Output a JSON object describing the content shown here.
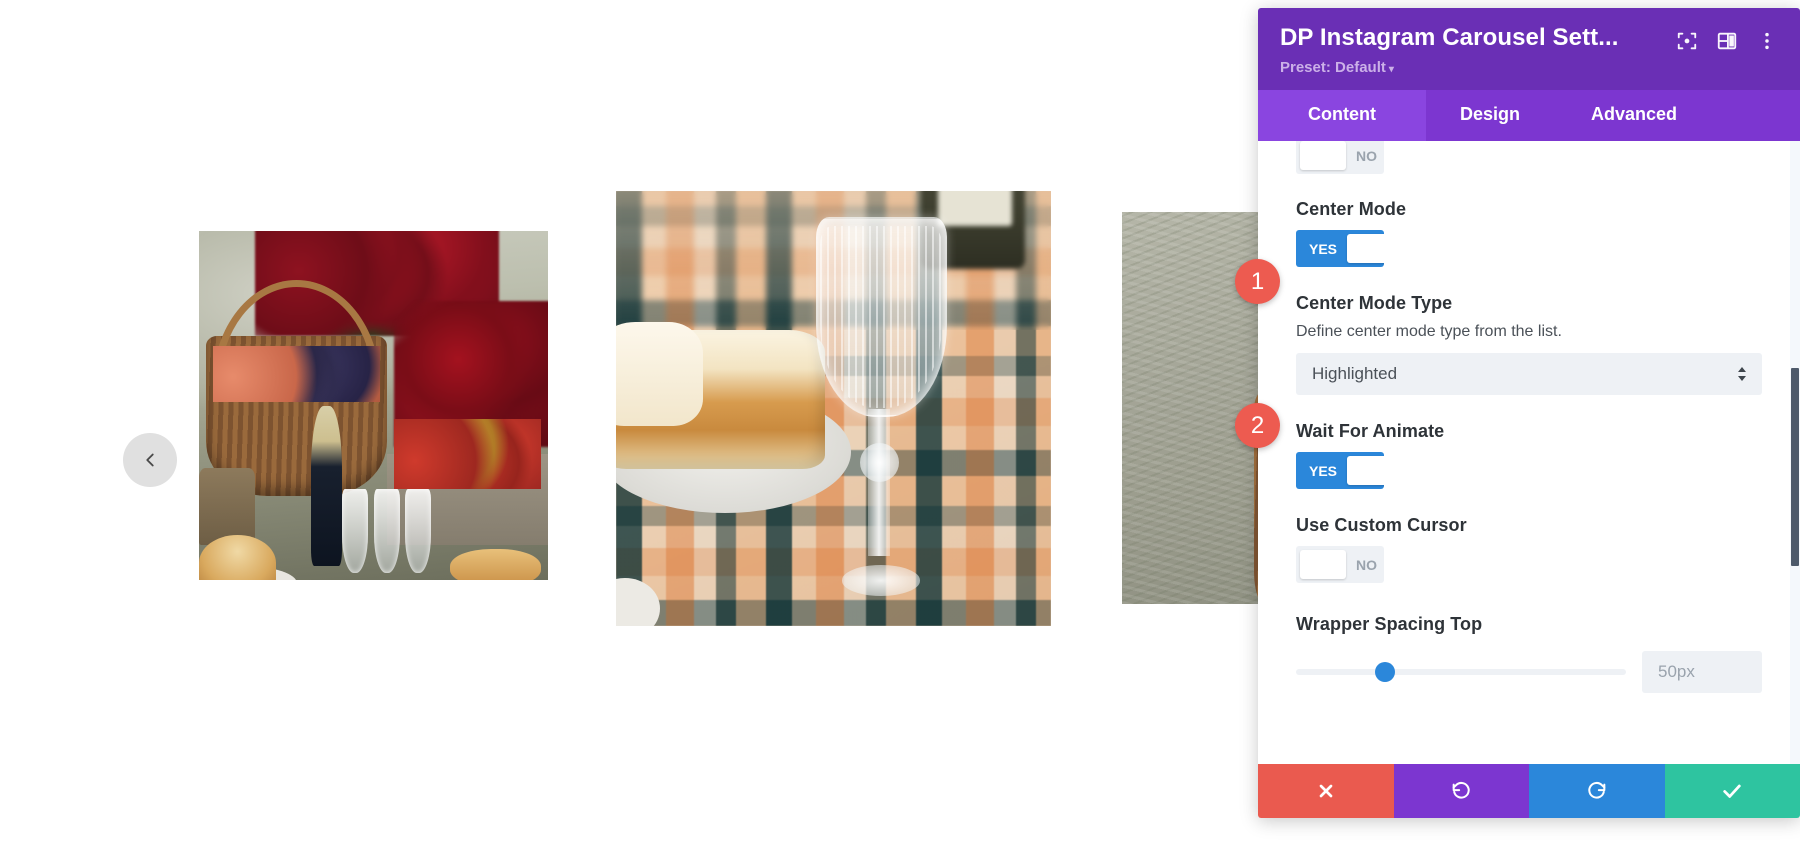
{
  "carousel": {
    "prev_button_icon": "chevron-left-icon",
    "slides": [
      {
        "alt": "Autumn harvest still life with red chrysanthemums, wicker basket of plums and apples, champagne bottle and crystal glasses",
        "position": "left"
      },
      {
        "alt": "Picnic scene with crystal wine glass and sliced cake on a plate over a plaid blanket",
        "position": "center-active"
      },
      {
        "alt": "Wicker basket with fruit on grassy ground",
        "position": "right-partial"
      }
    ]
  },
  "badges": [
    {
      "number": "1",
      "target": "center-mode-toggle"
    },
    {
      "number": "2",
      "target": "center-mode-type-select"
    }
  ],
  "panel": {
    "title": "DP Instagram Carousel Sett...",
    "preset_label": "Preset: Default",
    "preset_caret": "▾",
    "header_icons": [
      {
        "name": "focus-target-icon"
      },
      {
        "name": "layout-panel-icon"
      },
      {
        "name": "more-options-icon"
      }
    ],
    "tabs": [
      {
        "label": "Content",
        "active": true
      },
      {
        "label": "Design",
        "active": false
      },
      {
        "label": "Advanced",
        "active": false
      }
    ],
    "fields": [
      {
        "type": "toggle",
        "label": "",
        "state": "off",
        "state_label": "NO",
        "clipped": true
      },
      {
        "type": "toggle",
        "label": "Center Mode",
        "state": "on",
        "state_label": "YES"
      },
      {
        "type": "select",
        "label": "Center Mode Type",
        "help": "Define center mode type from the list.",
        "value": "Highlighted"
      },
      {
        "type": "toggle",
        "label": "Wait For Animate",
        "state": "on",
        "state_label": "YES"
      },
      {
        "type": "toggle",
        "label": "Use Custom Cursor",
        "state": "off",
        "state_label": "NO"
      },
      {
        "type": "slider",
        "label": "Wrapper Spacing Top",
        "value": "50px",
        "percent": 27
      }
    ],
    "footer_buttons": [
      {
        "name": "cancel-button",
        "icon": "close-icon",
        "color": "#ea5a4f"
      },
      {
        "name": "undo-button",
        "icon": "undo-icon",
        "color": "#7c36d0"
      },
      {
        "name": "redo-button",
        "icon": "redo-icon",
        "color": "#2b87da"
      },
      {
        "name": "save-button",
        "icon": "check-icon",
        "color": "#2ec4a0"
      }
    ],
    "scrollbar": {
      "visible": true
    }
  },
  "colors": {
    "header_purple": "#6a2fb5",
    "tab_bar_purple": "#7c36d0",
    "tab_active_purple": "#8a45e0",
    "toggle_on_blue": "#2b87da",
    "badge_red": "#ed5b50",
    "page_bg": "#ffffff"
  }
}
